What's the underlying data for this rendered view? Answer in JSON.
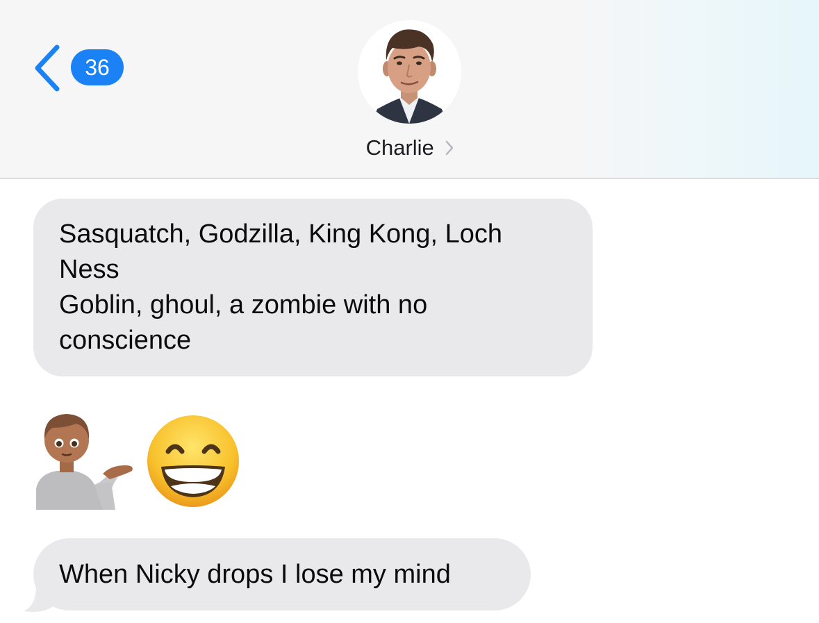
{
  "header": {
    "back_badge_count": "36",
    "contact_name": "Charlie"
  },
  "messages": [
    {
      "direction": "incoming",
      "lines": [
        "Sasquatch, Godzilla, King Kong, Loch",
        "Ness",
        "Goblin, ghoul, a zombie with no",
        "conscience"
      ]
    },
    {
      "direction": "incoming",
      "type": "emoji",
      "emoji": [
        "person-tipping-hand-icon",
        "grinning-face-with-smiling-eyes-icon"
      ]
    },
    {
      "direction": "incoming",
      "text": "When Nicky drops I lose my mind"
    }
  ],
  "colors": {
    "accent": "#1a82f5",
    "incoming_bubble": "#e9e9eb",
    "header_bg": "#f6f6f7"
  }
}
